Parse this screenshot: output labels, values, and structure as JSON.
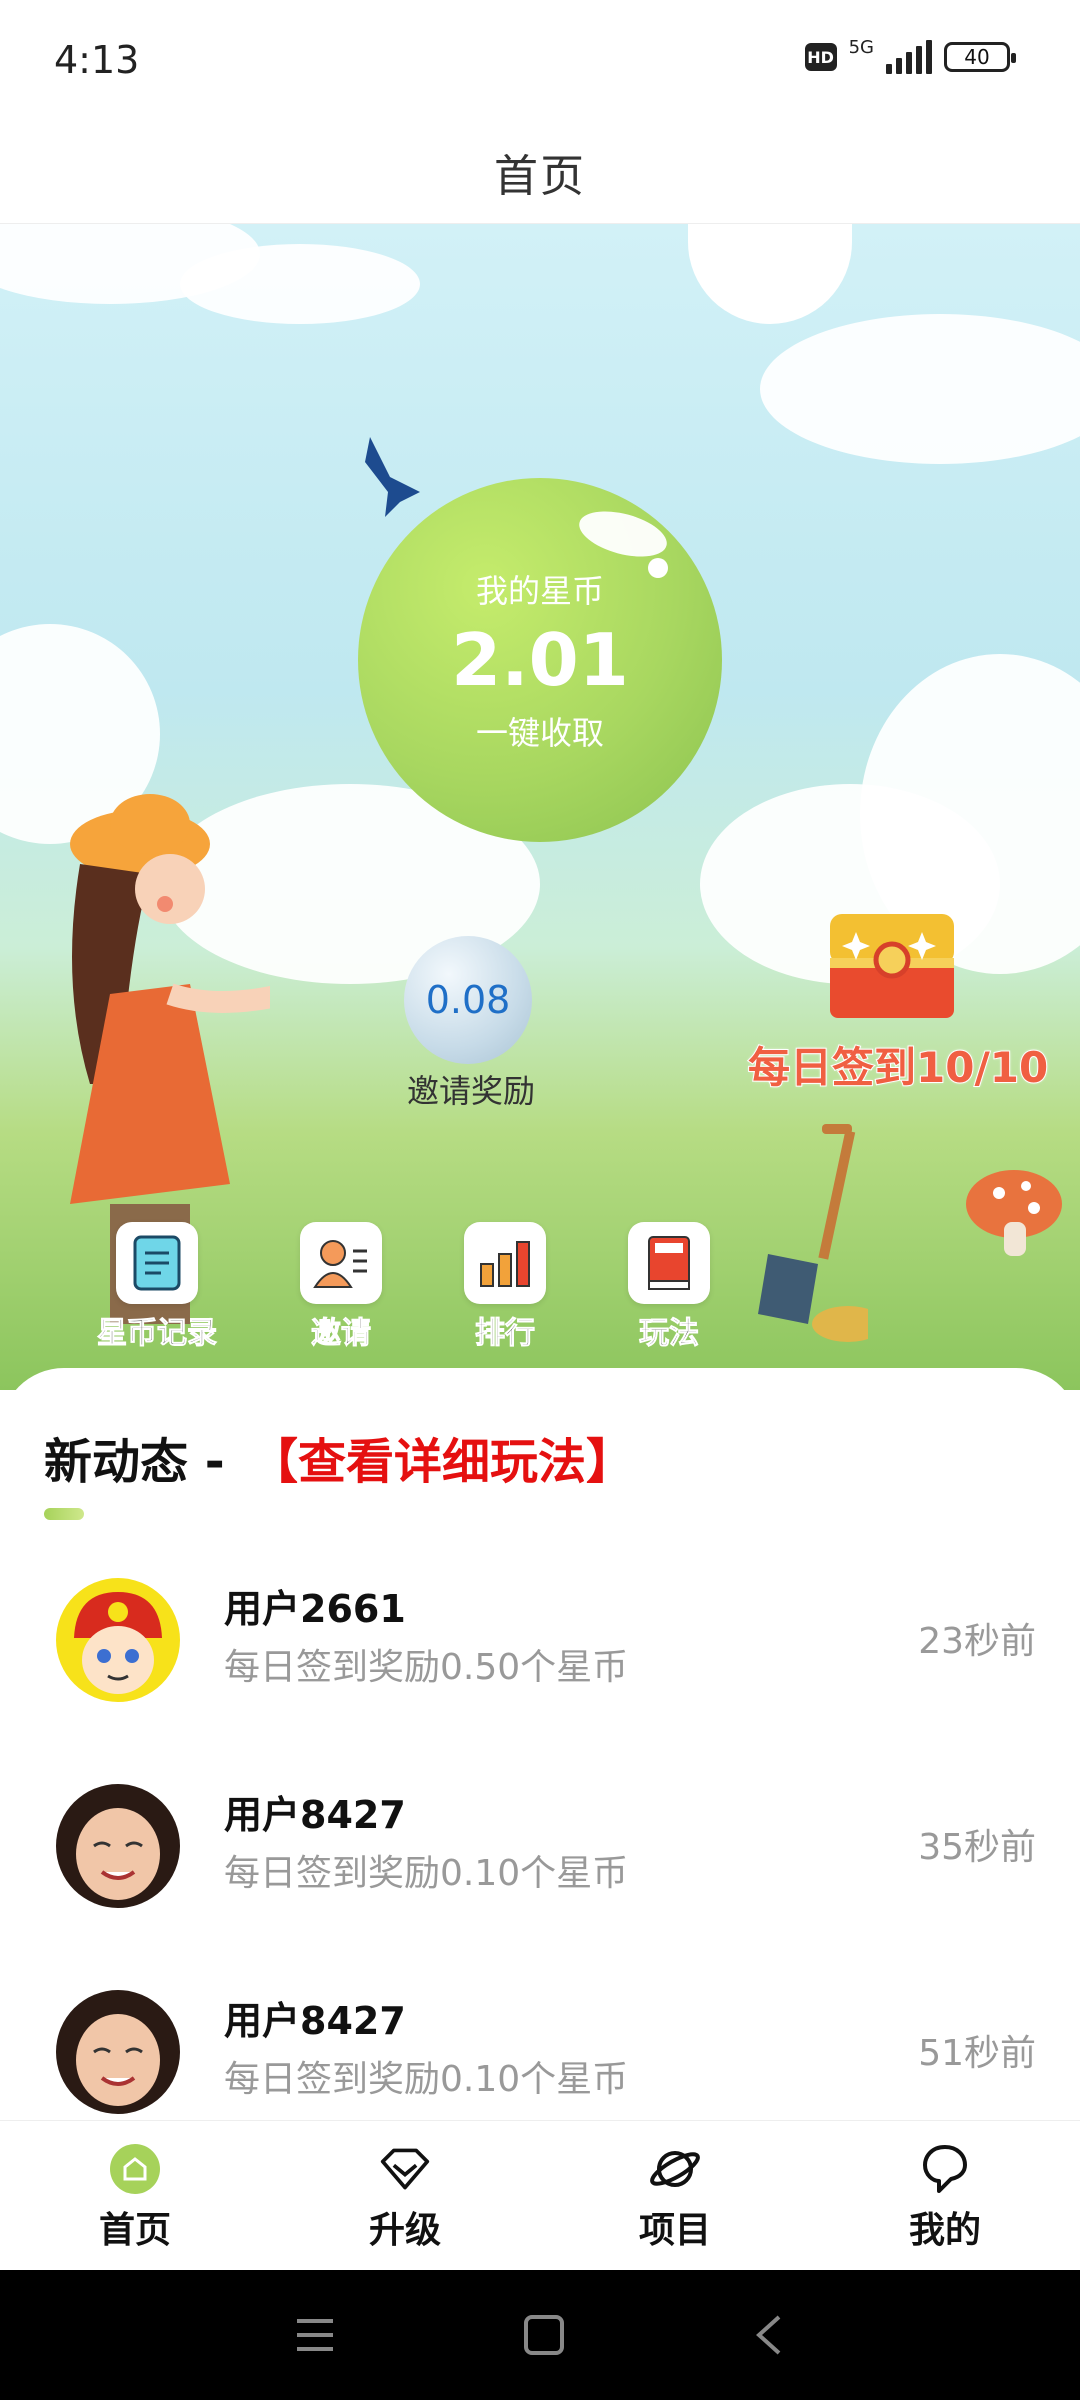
{
  "status": {
    "time": "4:13",
    "hd": "HD",
    "network": "5G",
    "battery": "40"
  },
  "header": {
    "title": "首页"
  },
  "hero": {
    "coin": {
      "label": "我的星币",
      "value": "2.01",
      "action": "一键收取"
    },
    "invite": {
      "value": "0.08",
      "label": "邀请奖励"
    },
    "checkin": {
      "label": "每日签到10/10"
    },
    "quick_actions": [
      {
        "label": "星币记录",
        "icon": "document-icon"
      },
      {
        "label": "邀请",
        "icon": "invite-user-icon"
      },
      {
        "label": "排行",
        "icon": "bar-chart-icon"
      },
      {
        "label": "玩法",
        "icon": "book-icon"
      }
    ]
  },
  "feed": {
    "title": "新动态 -",
    "link": "【查看详细玩法】",
    "items": [
      {
        "user": "用户2661",
        "desc": "每日签到奖励0.50个星币",
        "time": "23秒前"
      },
      {
        "user": "用户8427",
        "desc": "每日签到奖励0.10个星币",
        "time": "35秒前"
      },
      {
        "user": "用户8427",
        "desc": "每日签到奖励0.10个星币",
        "time": "51秒前"
      }
    ]
  },
  "tabs": [
    {
      "label": "首页",
      "icon": "home-icon",
      "active": true
    },
    {
      "label": "升级",
      "icon": "diamond-icon",
      "active": false
    },
    {
      "label": "项目",
      "icon": "planet-icon",
      "active": false
    },
    {
      "label": "我的",
      "icon": "profile-icon",
      "active": false
    }
  ],
  "colors": {
    "accent_green": "#a6d25a",
    "link_red": "#e51010",
    "checkin_orange": "#f05f42"
  }
}
